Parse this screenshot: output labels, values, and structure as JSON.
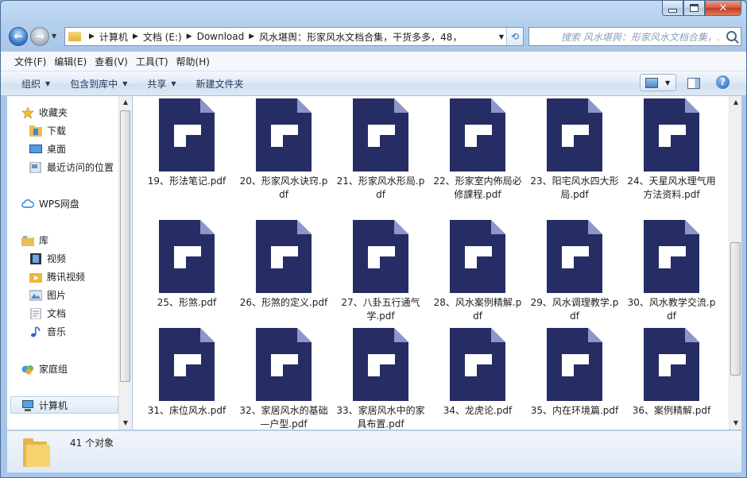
{
  "address": {
    "crumbs": [
      "计算机",
      "文档 (E:)",
      "Download",
      "风水堪舆：形家风水文档合集，干货多多，48，"
    ]
  },
  "search": {
    "placeholder": "搜索 风水堪舆：形家风水文档合集，..."
  },
  "menu": [
    "文件(F)",
    "编辑(E)",
    "查看(V)",
    "工具(T)",
    "帮助(H)"
  ],
  "commands": [
    "组织",
    "包含到库中",
    "共享",
    "新建文件夹"
  ],
  "nav": {
    "favorites": "收藏夹",
    "downloads": "下载",
    "desktop": "桌面",
    "recent": "最近访问的位置",
    "wps": "WPS网盘",
    "libraries": "库",
    "videos": "视频",
    "tencent_video": "腾讯视频",
    "pictures": "图片",
    "documents": "文档",
    "music": "音乐",
    "homegroup": "家庭组",
    "computer": "计算机"
  },
  "files": [
    "19、形法笔记.pdf",
    "20、形家风水诀窍.pdf",
    "21、形家风水形局.pdf",
    "22、形家室内佈局必修課程.pdf",
    "23、阳宅风水四大形局.pdf",
    "24、天星风水理气用方法资料.pdf",
    "25、形煞.pdf",
    "26、形煞的定义.pdf",
    "27、八卦五行通气学.pdf",
    "28、风水案例精解.pdf",
    "29、风水调理教学.pdf",
    "30、风水教学交流.pdf",
    "31、床位风水.pdf",
    "32、家居风水的基础—户型.pdf",
    "33、家居风水中的家具布置.pdf",
    "34、龙虎论.pdf",
    "35、内在环境篇.pdf",
    "36、案例精解.pdf"
  ],
  "status": {
    "count": "41 个对象"
  },
  "colors": {
    "pdf_icon": "#262d64",
    "pdf_fold": "#8e95c8",
    "window_frame": "#b4cfee"
  }
}
